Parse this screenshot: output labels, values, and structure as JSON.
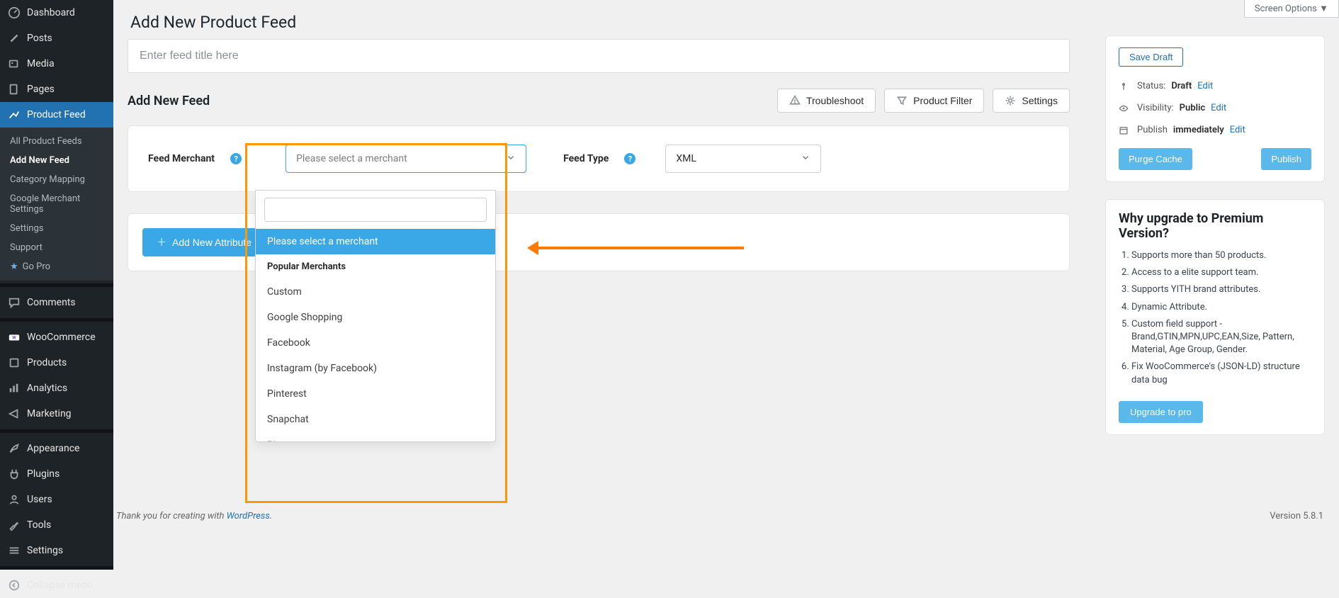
{
  "sidebar": {
    "items": [
      {
        "label": "Dashboard"
      },
      {
        "label": "Posts"
      },
      {
        "label": "Media"
      },
      {
        "label": "Pages"
      },
      {
        "label": "Product Feed"
      },
      {
        "label": "Comments"
      },
      {
        "label": "WooCommerce"
      },
      {
        "label": "Products"
      },
      {
        "label": "Analytics"
      },
      {
        "label": "Marketing"
      },
      {
        "label": "Appearance"
      },
      {
        "label": "Plugins"
      },
      {
        "label": "Users"
      },
      {
        "label": "Tools"
      },
      {
        "label": "Settings"
      },
      {
        "label": "Collapse menu"
      }
    ],
    "submenu": [
      {
        "label": "All Product Feeds"
      },
      {
        "label": "Add New Feed"
      },
      {
        "label": "Category Mapping"
      },
      {
        "label": "Google Merchant Settings"
      },
      {
        "label": "Settings"
      },
      {
        "label": "Support"
      },
      {
        "label": "Go Pro"
      }
    ]
  },
  "header": {
    "screen_options": "Screen Options",
    "page_title": "Add New Product Feed",
    "title_placeholder": "Enter feed title here"
  },
  "feed_head": {
    "title": "Add New Feed",
    "troubleshoot": "Troubleshoot",
    "product_filter": "Product Filter",
    "settings": "Settings"
  },
  "form": {
    "merchant_label": "Feed Merchant",
    "merchant_placeholder": "Please select a merchant",
    "feed_type_label": "Feed Type",
    "feed_type_value": "XML"
  },
  "dropdown": {
    "selected_text": "Please select a merchant",
    "group_label": "Popular Merchants",
    "options": [
      "Custom",
      "Google Shopping",
      "Facebook",
      "Instagram (by Facebook)",
      "Pinterest",
      "Snapchat",
      "Bing"
    ]
  },
  "attr_button": "Add New Attribute",
  "publish_box": {
    "save_draft": "Save Draft",
    "status_label": "Status:",
    "status_value": "Draft",
    "visibility_label": "Visibility:",
    "visibility_value": "Public",
    "publish_label": "Publish",
    "publish_value": "immediately",
    "edit": "Edit",
    "purge": "Purge Cache",
    "publish_btn": "Publish"
  },
  "upgrade": {
    "title": "Why upgrade to Premium Version?",
    "items": [
      "Supports more than 50 products.",
      "Access to a elite support team.",
      "Supports YITH brand attributes.",
      "Dynamic Attribute.",
      "Custom field support - Brand,GTIN,MPN,UPC,EAN,Size, Pattern, Material, Age Group, Gender.",
      "Fix WooCommerce's (JSON-LD) structure data bug"
    ],
    "button": "Upgrade to pro"
  },
  "footer": {
    "thanks_prefix": "Thank you for creating with ",
    "wp": "WordPress",
    "period": ".",
    "version": "Version 5.8.1"
  }
}
